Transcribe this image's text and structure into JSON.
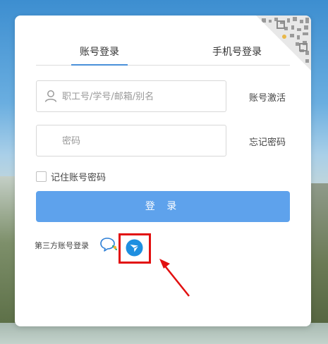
{
  "tabs": [
    {
      "label": "账号登录",
      "active": true
    },
    {
      "label": "手机号登录",
      "active": false
    }
  ],
  "username": {
    "placeholder": "职工号/学号/邮箱/别名",
    "value": ""
  },
  "password": {
    "placeholder": "密码",
    "value": ""
  },
  "links": {
    "activate": "账号激活",
    "forgot": "忘记密码"
  },
  "remember_label": "记住账号密码",
  "login_button": "登 录",
  "third_party": {
    "label": "第三方账号登录",
    "providers": [
      {
        "icon": "chat-bubble-icon"
      },
      {
        "icon": "feishu-bird-icon"
      }
    ]
  },
  "colors": {
    "accent": "#5ea2ec",
    "tab_underline": "#4a90d9",
    "highlight": "#e21010",
    "feishu": "#1e8fe0"
  }
}
